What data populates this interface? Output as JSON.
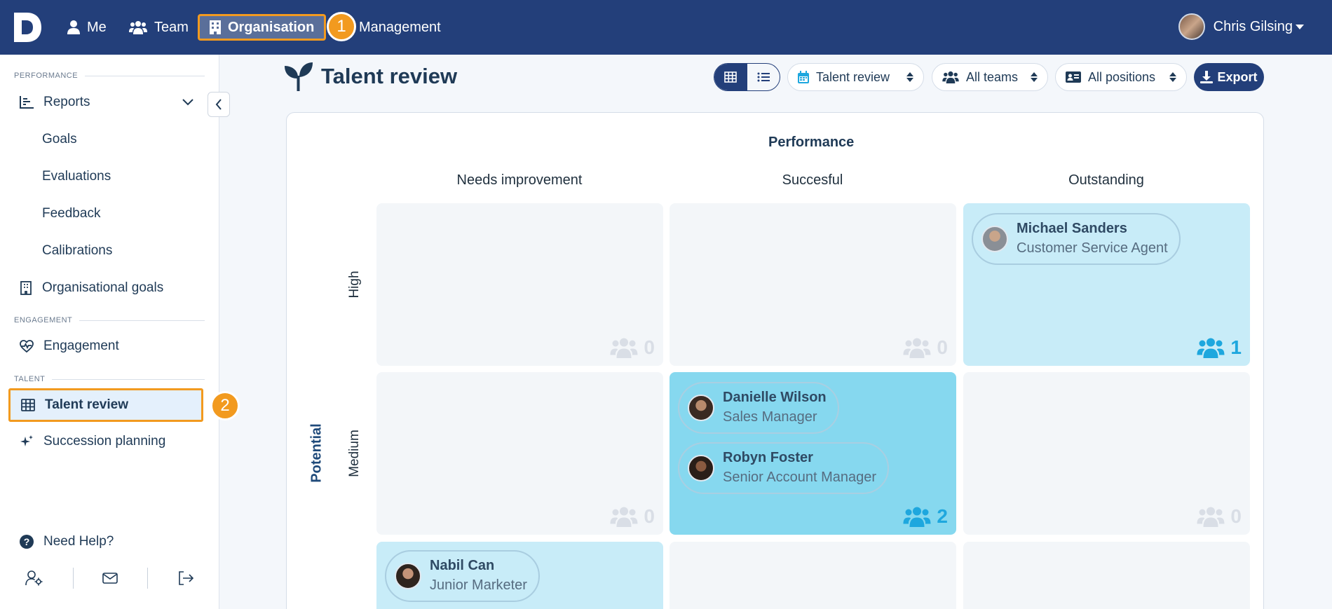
{
  "nav": {
    "me": "Me",
    "team": "Team",
    "organisation": "Organisation",
    "management": "Management",
    "user_name": "Chris Gilsing",
    "step1": "1"
  },
  "sidebar": {
    "performance_label": "PERFORMANCE",
    "reports": "Reports",
    "goals": "Goals",
    "evaluations": "Evaluations",
    "feedback": "Feedback",
    "calibrations": "Calibrations",
    "org_goals": "Organisational goals",
    "engagement_label": "ENGAGEMENT",
    "engagement": "Engagement",
    "talent_label": "TALENT",
    "talent_review": "Talent review",
    "succession": "Succession planning",
    "step2": "2",
    "help": "Need Help?"
  },
  "header": {
    "title": "Talent review",
    "filter_review": "Talent review",
    "filter_teams": "All teams",
    "filter_positions": "All positions",
    "export": "Export"
  },
  "grid": {
    "performance_axis": "Performance",
    "potential_axis": "Potential",
    "columns": [
      "Needs improvement",
      "Succesful",
      "Outstanding"
    ],
    "rows": [
      "High",
      "Medium"
    ],
    "counts": {
      "high_needs": "0",
      "high_succ": "0",
      "high_out": "1",
      "med_needs": "0",
      "med_succ": "2",
      "med_out": "0"
    },
    "employees": {
      "michael": {
        "name": "Michael Sanders",
        "role": "Customer Service Agent"
      },
      "danielle": {
        "name": "Danielle Wilson",
        "role": "Sales Manager"
      },
      "robyn": {
        "name": "Robyn Foster",
        "role": "Senior Account Manager"
      },
      "nabil": {
        "name": "Nabil Can",
        "role": "Junior Marketer"
      }
    }
  },
  "colors": {
    "nav_bg": "#233f7a",
    "accent_orange": "#f29a1f",
    "cell_light": "#c8ecf8",
    "cell_mid": "#86d8ef",
    "count_blue": "#1ea7de"
  }
}
